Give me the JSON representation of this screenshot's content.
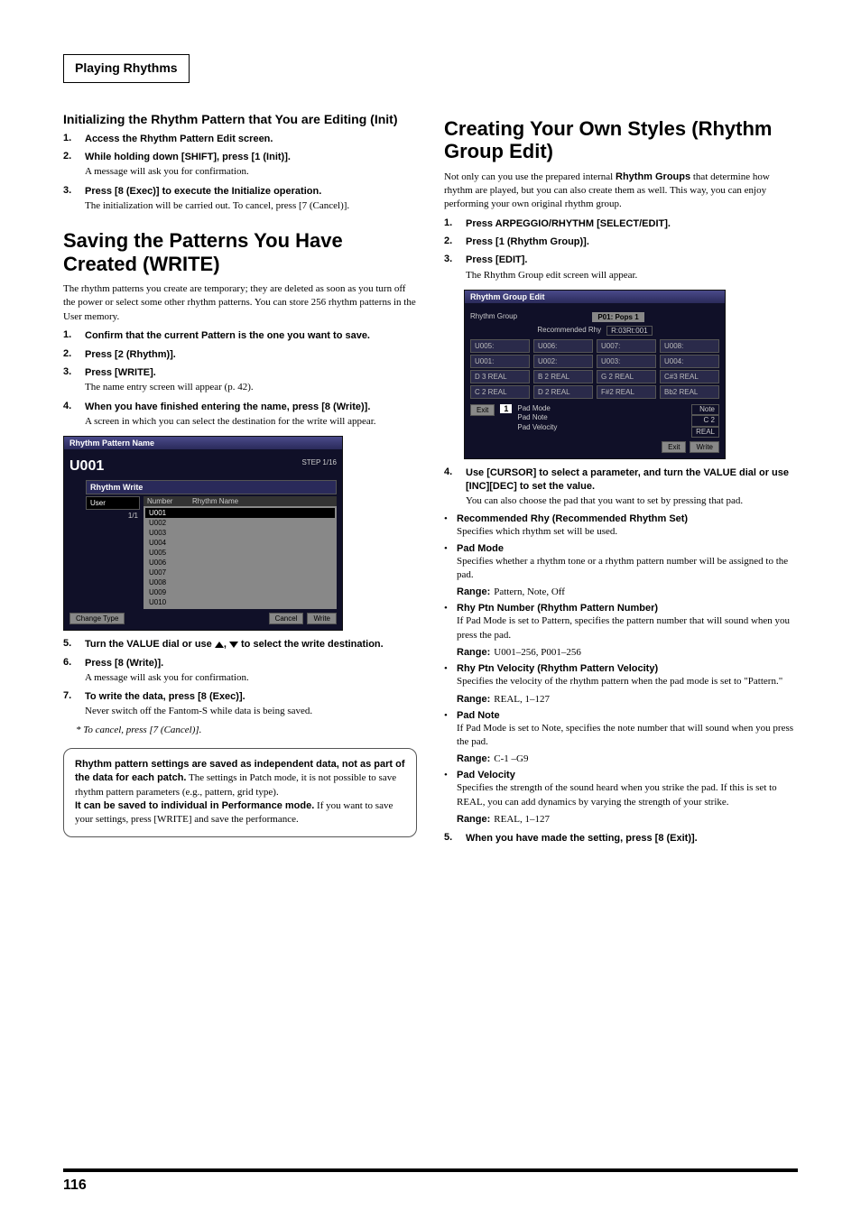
{
  "section_header": "Playing Rhythms",
  "page_number": "116",
  "left": {
    "h2_init": "Initializing the Rhythm Pattern that You are Editing (Init)",
    "init_steps": [
      {
        "num": "1.",
        "title": "Access the Rhythm Pattern Edit screen."
      },
      {
        "num": "2.",
        "title": "While holding down [SHIFT], press [1 (Init)].",
        "body": "A message will ask you for confirmation."
      },
      {
        "num": "3.",
        "title": "Press [8 (Exec)] to execute the Initialize operation.",
        "body": "The initialization will be carried out. To cancel, press [7 (Cancel)]."
      }
    ],
    "h1_save": "Saving the Patterns You Have Created (WRITE)",
    "save_intro": "The rhythm patterns you create are temporary; they are deleted as soon as you turn off the power or select some other rhythm patterns. You can store 256 rhythm patterns in the User memory.",
    "save_steps_a": [
      {
        "num": "1.",
        "title": "Confirm that the current Pattern is the one you want to save."
      },
      {
        "num": "2.",
        "title": "Press [2 (Rhythm)]."
      },
      {
        "num": "3.",
        "title": "Press [WRITE].",
        "body": "The name entry screen will appear (p. 42)."
      },
      {
        "num": "4.",
        "title": "When you have finished entering the name, press [8 (Write)].",
        "body": "A screen in which you can select the destination for the write will appear."
      }
    ],
    "screenshot1": {
      "title": "Rhythm Pattern Name",
      "name": "U001",
      "step": "STEP  1/16",
      "subwin": "Rhythm Write",
      "tab": "User",
      "pages": "1/1",
      "col_number": "Number",
      "col_name": "Rhythm Name",
      "list": [
        "U001",
        "U002",
        "U003",
        "U004",
        "U005",
        "U006",
        "U007",
        "U008",
        "U009",
        "U010"
      ],
      "btn_changetype": "Change Type",
      "btn_cancel": "Cancel",
      "btn_write": "Write"
    },
    "step5_pre": "Turn the VALUE dial or use ",
    "step5_post": " to select the write destination.",
    "save_steps_b": [
      {
        "num": "6.",
        "title": "Press [8 (Write)].",
        "body": "A message will ask you for confirmation."
      },
      {
        "num": "7.",
        "title": "To write the data, press [8 (Exec)].",
        "body": "Never switch off the Fantom-S while data is being saved."
      }
    ],
    "cancel_note": "To cancel, press [7 (Cancel)].",
    "note_box": {
      "s1": "Rhythm pattern settings are saved as independent data, not as part of the data for each patch.",
      "b1": " The settings in Patch mode, it is not possible to save rhythm pattern parameters (e.g., pattern, grid type).",
      "s2": "It can be saved to individual in Performance mode.",
      "b2": " If you want to save your settings, press [WRITE] and save the performance."
    }
  },
  "right": {
    "h1_create": "Creating Your Own Styles (Rhythm Group Edit)",
    "create_intro_pre": "Not only can you use the prepared internal ",
    "create_intro_strong": "Rhythm Groups",
    "create_intro_post": " that determine how rhythm are played, but you can also create them as well. This way, you can enjoy performing your own original rhythm group.",
    "create_steps_a": [
      {
        "num": "1.",
        "title": "Press ARPEGGIO/RHYTHM [SELECT/EDIT]."
      },
      {
        "num": "2.",
        "title": "Press [1 (Rhythm Group)]."
      },
      {
        "num": "3.",
        "title": "Press [EDIT].",
        "body": "The Rhythm Group edit screen will appear."
      }
    ],
    "screenshot2": {
      "title": "Rhythm Group Edit",
      "label_group": "Rhythm Group",
      "group_val": "P01: Pops 1",
      "rec_label": "Recommended Rhy",
      "rec_val": "R:03Rt:001",
      "cells_top": [
        "U005:",
        "U006:",
        "U007:",
        "U008:",
        "U001:",
        "U002:",
        "U003:",
        "U004:"
      ],
      "cells_bot": [
        "D 3   REAL",
        "B 2   REAL",
        "G 2   REAL",
        "C#3   REAL",
        "C 2   REAL",
        "D 2   REAL",
        "F#2   REAL",
        "Bb2   REAL"
      ],
      "btn_exit_l": "Exit",
      "pad_sel": "1",
      "pad_mode": "Pad Mode",
      "pad_note": "Pad Note",
      "pad_vel": "Pad Velocity",
      "val_note": "Note",
      "val_c2": "C 2",
      "val_real": "REAL",
      "btn_exit": "Exit",
      "btn_write": "Write"
    },
    "step4_title": "Use [CURSOR] to select a parameter, and turn the VALUE dial or use [INC][DEC] to set the value.",
    "step4_body": "You can also choose the pad that you want to set by pressing that pad.",
    "bullets": [
      {
        "title": "Recommended Rhy (Recommended Rhythm Set)",
        "body": "Specifies which rhythm set will be used."
      },
      {
        "title": "Pad Mode",
        "body": "Specifies whether a rhythm tone or a rhythm pattern number will be assigned to the pad.",
        "range": "Pattern, Note, Off"
      },
      {
        "title": "Rhy Ptn Number (Rhythm Pattern Number)",
        "body": "If Pad Mode is set to Pattern, specifies the pattern number that will sound when you press the pad.",
        "range": "U001–256, P001–256"
      },
      {
        "title": "Rhy Ptn Velocity (Rhythm Pattern Velocity)",
        "body": "Specifies the velocity of the rhythm pattern when the pad mode is set to \"Pattern.\"",
        "range": "REAL, 1–127"
      },
      {
        "title": "Pad Note",
        "body": "If Pad Mode is set to Note, specifies the note number that will sound when you press the pad.",
        "range": "C-1 –G9"
      },
      {
        "title": "Pad Velocity",
        "body": "Specifies the strength of the sound heard when you strike the pad. If this is set to REAL, you can add dynamics by varying the strength of your strike.",
        "range": "REAL, 1–127"
      }
    ],
    "range_label": "Range:",
    "step5_title": "When you have made the setting, press [8 (Exit)]."
  }
}
